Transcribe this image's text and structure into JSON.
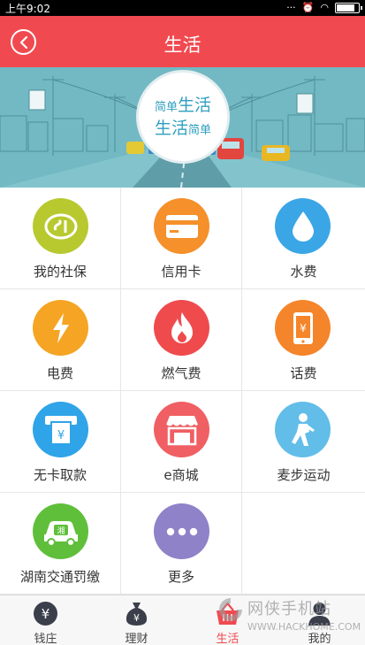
{
  "status_bar": {
    "time": "上午9:02",
    "battery_level": 0.85
  },
  "header": {
    "title": "生活",
    "back_icon": "chevron-left-icon"
  },
  "banner": {
    "line1_small": "简单",
    "line1_big": "生活",
    "line2_big": "生活",
    "line2_small": "简单",
    "colors": {
      "sky": "#6fb7c2",
      "text": "#2f9fc0"
    }
  },
  "services": [
    {
      "label": "我的社保",
      "icon": "social-security-icon",
      "color": "#b8c930"
    },
    {
      "label": "信用卡",
      "icon": "credit-card-icon",
      "color": "#f5902a"
    },
    {
      "label": "水费",
      "icon": "water-drop-icon",
      "color": "#3aa6e6"
    },
    {
      "label": "电费",
      "icon": "lightning-icon",
      "color": "#f5a523"
    },
    {
      "label": "燃气费",
      "icon": "flame-icon",
      "color": "#ef4b4d"
    },
    {
      "label": "话费",
      "icon": "phone-bill-icon",
      "color": "#f5852a"
    },
    {
      "label": "无卡取款",
      "icon": "atm-icon",
      "color": "#2fa4e8"
    },
    {
      "label": "e商城",
      "icon": "shop-icon",
      "color": "#ef5f63"
    },
    {
      "label": "麦步运动",
      "icon": "runner-icon",
      "color": "#62bde8"
    },
    {
      "label": "湖南交通罚缴",
      "icon": "car-icon",
      "color": "#5fbf3a",
      "plate": "湘"
    },
    {
      "label": "更多",
      "icon": "more-dots-icon",
      "color": "#8f82c8"
    }
  ],
  "tabs": [
    {
      "label": "钱庄",
      "icon": "yen-circle-icon",
      "active": false
    },
    {
      "label": "理财",
      "icon": "money-bag-icon",
      "active": false
    },
    {
      "label": "生活",
      "icon": "basket-icon",
      "active": true
    },
    {
      "label": "我的",
      "icon": "person-icon",
      "active": false
    }
  ],
  "watermark": {
    "text": "网侠手机站",
    "url": "WWW.HACKHOME.COM"
  },
  "accent_color": "#f04a50"
}
